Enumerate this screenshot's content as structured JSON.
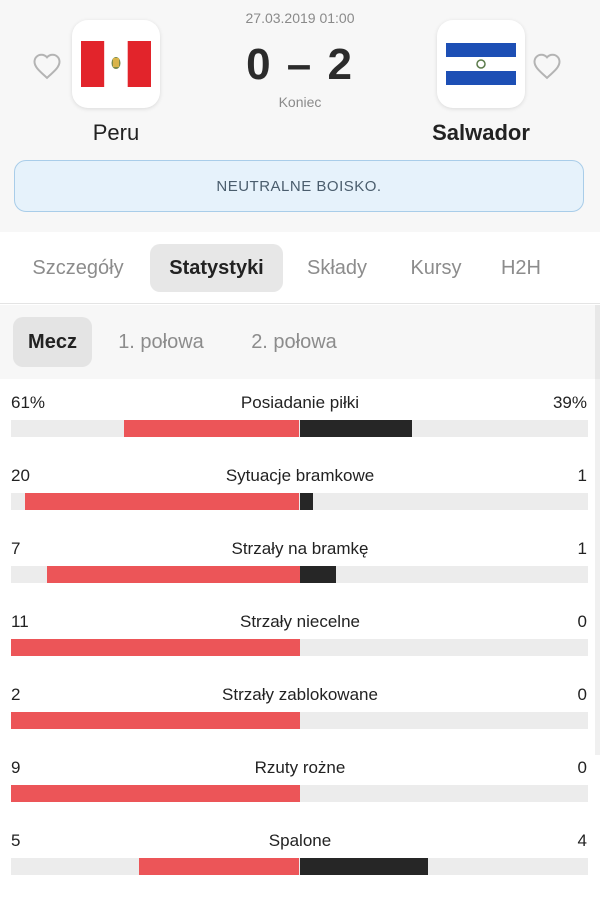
{
  "match": {
    "datetime": "27.03.2019 01:00",
    "score": "0 – 2",
    "status": "Koniec",
    "home": {
      "name": "Peru",
      "flag_icon": "peru-flag-icon"
    },
    "away": {
      "name": "Salwador",
      "flag_icon": "el-salvador-flag-icon"
    },
    "notice": "NEUTRALNE BOISKO."
  },
  "tabs": [
    {
      "label": "Szczegóły",
      "active": false
    },
    {
      "label": "Statystyki",
      "active": true
    },
    {
      "label": "Składy",
      "active": false
    },
    {
      "label": "Kursy",
      "active": false
    },
    {
      "label": "H2H",
      "active": false
    }
  ],
  "subtabs": [
    {
      "label": "Mecz",
      "active": true
    },
    {
      "label": "1. połowa",
      "active": false
    },
    {
      "label": "2. połowa",
      "active": false
    }
  ],
  "colors": {
    "home_bar": "#ec5558",
    "away_bar": "#262626",
    "track": "#ececec",
    "notice_bg": "#e6f2fb"
  },
  "stats": [
    {
      "label": "Posiadanie piłki",
      "home": "61%",
      "away": "39%",
      "home_value": 61,
      "away_value": 39
    },
    {
      "label": "Sytuacje bramkowe",
      "home": "20",
      "away": "1",
      "home_value": 20,
      "away_value": 1
    },
    {
      "label": "Strzały na bramkę",
      "home": "7",
      "away": "1",
      "home_value": 7,
      "away_value": 1
    },
    {
      "label": "Strzały niecelne",
      "home": "11",
      "away": "0",
      "home_value": 11,
      "away_value": 0
    },
    {
      "label": "Strzały zablokowane",
      "home": "2",
      "away": "0",
      "home_value": 2,
      "away_value": 0
    },
    {
      "label": "Rzuty rożne",
      "home": "9",
      "away": "0",
      "home_value": 9,
      "away_value": 0
    },
    {
      "label": "Spalone",
      "home": "5",
      "away": "4",
      "home_value": 5,
      "away_value": 4
    }
  ]
}
